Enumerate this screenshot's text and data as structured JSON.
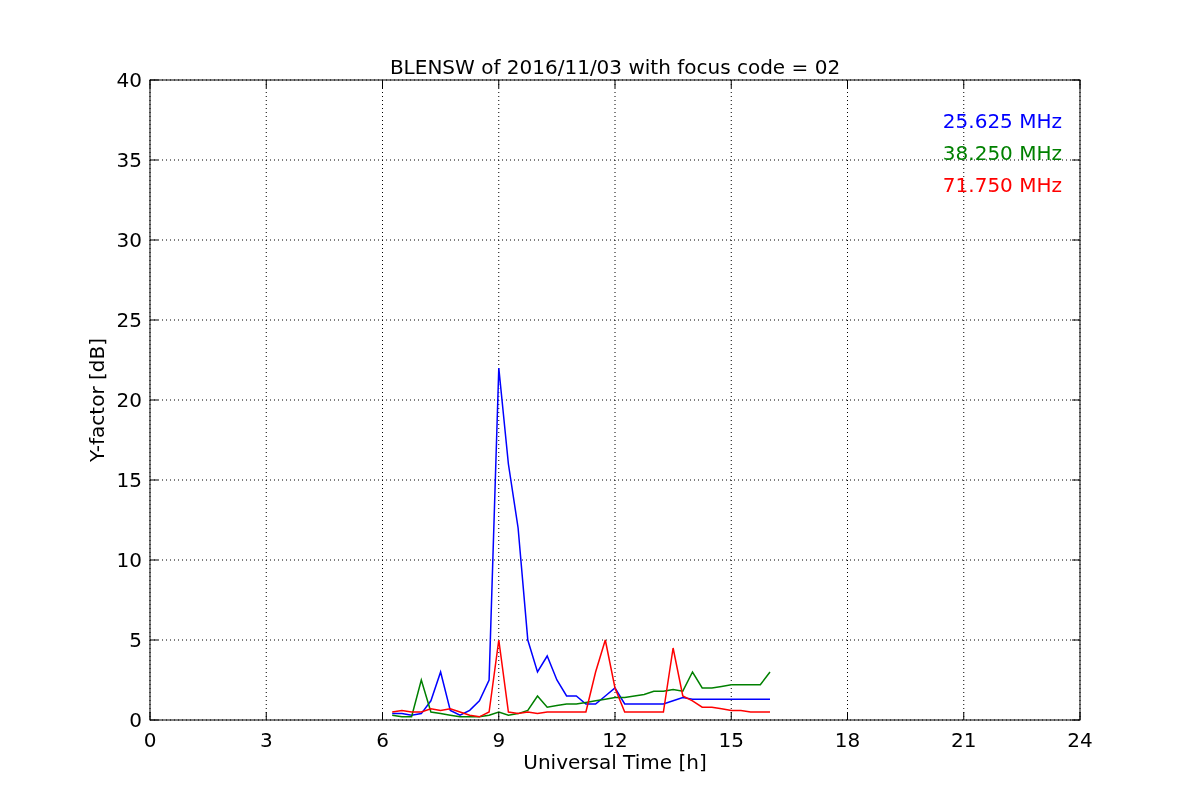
{
  "chart_data": {
    "type": "line",
    "title": "BLENSW of 2016/11/03 with focus code = 02",
    "xlabel": "Universal Time [h]",
    "ylabel": "Y-factor [dB]",
    "x": [
      6.25,
      6.5,
      6.75,
      7,
      7.25,
      7.5,
      7.75,
      8,
      8.25,
      8.5,
      8.75,
      9,
      9.25,
      9.5,
      9.75,
      10,
      10.25,
      10.5,
      10.75,
      11,
      11.25,
      11.5,
      11.75,
      12,
      12.25,
      12.5,
      12.75,
      13,
      13.25,
      13.5,
      13.75,
      14,
      14.25,
      14.5,
      14.75,
      15,
      15.25,
      15.5,
      15.75,
      16
    ],
    "series": [
      {
        "name": "25.625 MHz",
        "color": "#0000ff",
        "values": [
          0.4,
          0.4,
          0.3,
          0.4,
          1.2,
          3.0,
          0.6,
          0.3,
          0.6,
          1.2,
          2.5,
          22.0,
          16.0,
          12.0,
          5.0,
          3.0,
          4.0,
          2.5,
          1.5,
          1.5,
          1.0,
          1.0,
          1.5,
          2.0,
          1.0,
          1.0,
          1.0,
          1.0,
          1.0,
          1.2,
          1.4,
          1.3,
          1.3,
          1.3,
          1.3,
          1.3,
          1.3,
          1.3,
          1.3,
          1.3
        ]
      },
      {
        "name": "38.250 MHz",
        "color": "#008000",
        "values": [
          0.3,
          0.2,
          0.2,
          2.5,
          0.5,
          0.4,
          0.3,
          0.2,
          0.2,
          0.2,
          0.3,
          0.5,
          0.3,
          0.4,
          0.6,
          1.5,
          0.8,
          0.9,
          1.0,
          1.0,
          1.1,
          1.2,
          1.3,
          1.4,
          1.4,
          1.5,
          1.6,
          1.8,
          1.8,
          1.9,
          1.8,
          3.0,
          2.0,
          2.0,
          2.1,
          2.2,
          2.2,
          2.2,
          2.2,
          3.0
        ]
      },
      {
        "name": "71.750 MHz",
        "color": "#ff0000",
        "values": [
          0.5,
          0.6,
          0.5,
          0.5,
          0.7,
          0.6,
          0.7,
          0.5,
          0.3,
          0.2,
          0.5,
          5.0,
          0.5,
          0.4,
          0.5,
          0.4,
          0.5,
          0.5,
          0.5,
          0.5,
          0.5,
          3.0,
          5.0,
          2.0,
          0.5,
          0.5,
          0.5,
          0.5,
          0.5,
          4.5,
          1.5,
          1.2,
          0.8,
          0.8,
          0.7,
          0.6,
          0.6,
          0.5,
          0.5,
          0.5
        ]
      }
    ],
    "xlim": [
      0,
      24
    ],
    "ylim": [
      0,
      40
    ],
    "xticks": [
      0,
      3,
      6,
      9,
      12,
      15,
      18,
      21,
      24
    ],
    "yticks": [
      0,
      5,
      10,
      15,
      20,
      25,
      30,
      35,
      40
    ],
    "grid": true
  }
}
